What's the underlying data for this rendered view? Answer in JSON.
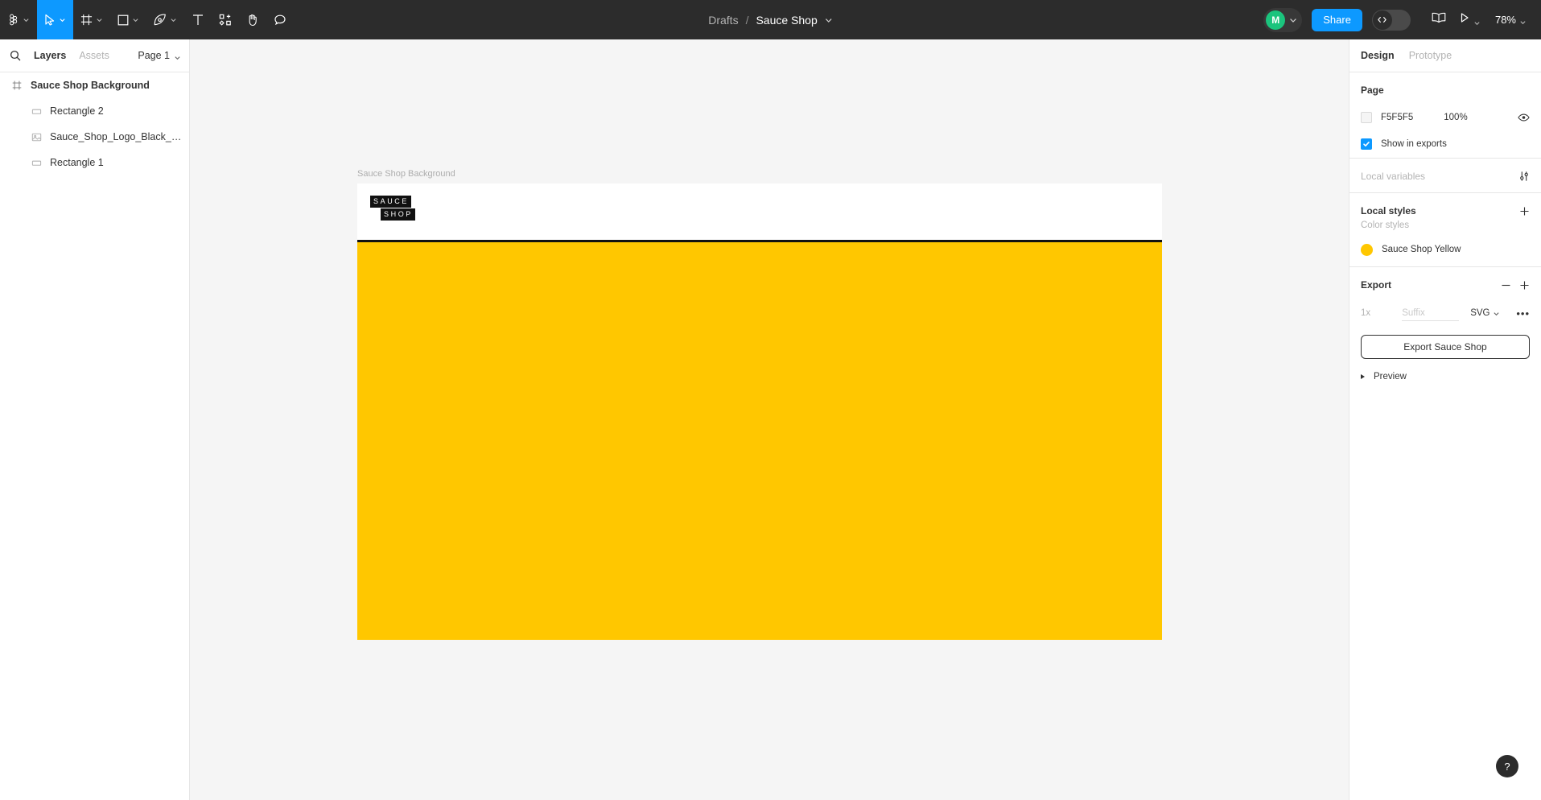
{
  "app": {
    "name": "Figma"
  },
  "toolbar": {
    "menu_label": "figma-menu",
    "tools": [
      {
        "name": "figma-menu",
        "icon": "figma-logo-icon",
        "has_caret": true,
        "active": false
      },
      {
        "name": "move-tool",
        "icon": "cursor-icon",
        "has_caret": true,
        "active": true
      },
      {
        "name": "frame-tool",
        "icon": "frame-icon",
        "has_caret": true,
        "active": false
      },
      {
        "name": "shape-tool",
        "icon": "square-icon",
        "has_caret": true,
        "active": false
      },
      {
        "name": "pen-tool",
        "icon": "pen-icon",
        "has_caret": true,
        "active": false
      },
      {
        "name": "text-tool",
        "icon": "text-icon",
        "has_caret": false,
        "active": false
      },
      {
        "name": "resources-tool",
        "icon": "components-icon",
        "has_caret": false,
        "active": false
      },
      {
        "name": "hand-tool",
        "icon": "hand-icon",
        "has_caret": false,
        "active": false
      },
      {
        "name": "comment-tool",
        "icon": "comment-icon",
        "has_caret": false,
        "active": false
      }
    ]
  },
  "breadcrumb": {
    "parent": "Drafts",
    "separator": "/",
    "file": "Sauce Shop",
    "caret_icon": "chevron-down-icon"
  },
  "topbar_right": {
    "avatar_initial": "M",
    "avatar_color": "#1bc47d",
    "share_label": "Share",
    "devmode_icon": "code-icon",
    "library_icon": "book-icon",
    "present_icon": "play-icon",
    "zoom_level": "78%",
    "accent_color": "#0d99ff"
  },
  "left_panel": {
    "search_icon": "search-icon",
    "tabs": [
      {
        "label": "Layers",
        "active": true
      },
      {
        "label": "Assets",
        "active": false
      }
    ],
    "page_selector": "Page 1",
    "layers": [
      {
        "name": "Sauce Shop Background",
        "icon": "frame-icon",
        "depth": 0
      },
      {
        "name": "Rectangle 2",
        "icon": "rectangle-icon",
        "depth": 1
      },
      {
        "name": "Sauce_Shop_Logo_Black_No_...",
        "icon": "image-icon",
        "depth": 1
      },
      {
        "name": "Rectangle 1",
        "icon": "rectangle-icon",
        "depth": 1
      }
    ]
  },
  "canvas": {
    "frame_label": "Sauce Shop Background",
    "background_color": "#f5f5f5",
    "frame": {
      "top_band_color": "#ffffff",
      "rule_color": "#111111",
      "body_color": "#FFC700"
    },
    "logo": {
      "line1": "SAUCE",
      "line2": "SHOP",
      "box_color": "#111111",
      "text_color": "#ffffff"
    }
  },
  "right_panel": {
    "tabs": [
      {
        "label": "Design",
        "active": true
      },
      {
        "label": "Prototype",
        "active": false
      }
    ],
    "page": {
      "title": "Page",
      "fill_hex": "F5F5F5",
      "fill_swatch": "#F5F5F5",
      "opacity": "100%",
      "visibility_icon": "eye-icon",
      "show_in_exports_label": "Show in exports",
      "show_in_exports_checked": true
    },
    "local_variables": {
      "title": "Local variables",
      "action_icon": "sliders-icon"
    },
    "local_styles": {
      "title": "Local styles",
      "add_icon": "plus-icon",
      "color_styles_label": "Color styles",
      "styles": [
        {
          "name": "Sauce Shop Yellow",
          "color": "#FFC700"
        }
      ]
    },
    "export": {
      "title": "Export",
      "minus_icon": "minus-icon",
      "plus_icon": "plus-icon",
      "scale": "1x",
      "suffix_placeholder": "Suffix",
      "format": "SVG",
      "more_icon": "ellipsis-icon",
      "export_button_label": "Export Sauce Shop",
      "preview_label": "Preview"
    }
  },
  "help": {
    "label": "?",
    "icon": "question-icon"
  }
}
